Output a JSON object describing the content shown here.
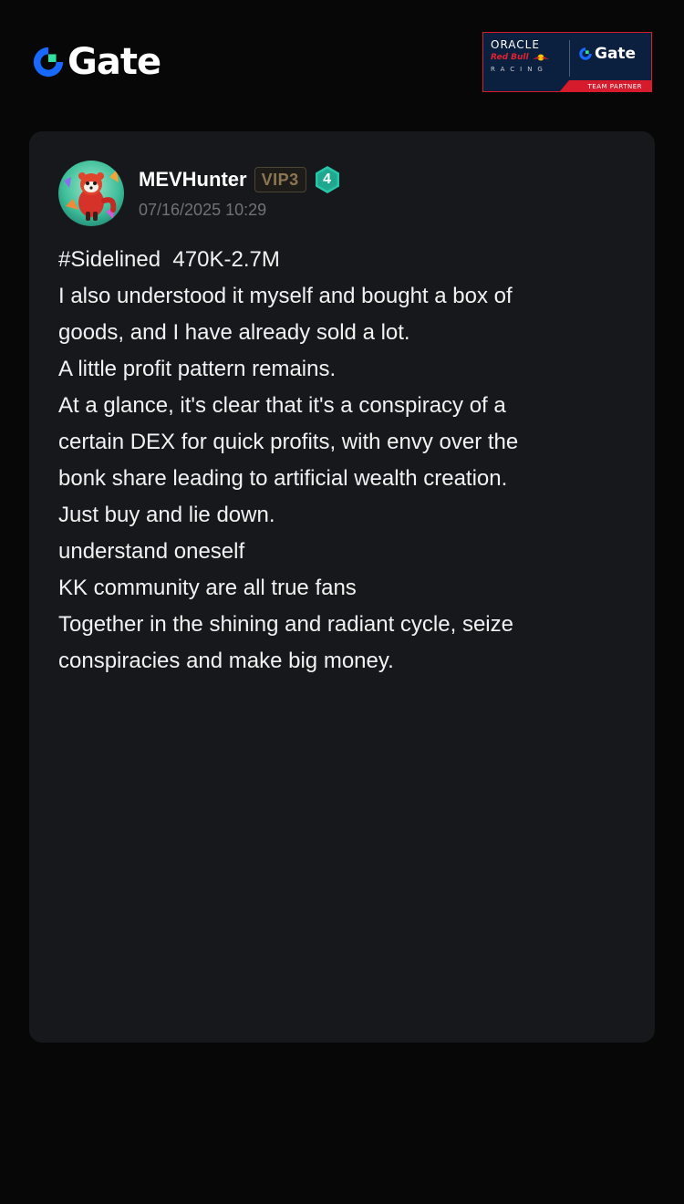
{
  "header": {
    "brand_name": "Gate",
    "logo_icon": "gate-logo-icon",
    "partner": {
      "oracle": "ORACLE",
      "red_bull": "Red Bull",
      "racing": "RACING",
      "gate": "Gate",
      "team_partner": "TEAM PARTNER"
    }
  },
  "post": {
    "author": {
      "username": "MEVHunter",
      "vip": "VIP3",
      "level": "4",
      "avatar_icon": "red-panda-avatar"
    },
    "timestamp": "07/16/2025 10:29",
    "lines": [
      "#Sidelined  470K-2.7M",
      "I also understood it myself and bought a box of",
      "goods, and I have already sold a lot.",
      "A little profit pattern remains.",
      "At a glance, it's clear that it's a conspiracy of a",
      "certain DEX for quick profits, with envy over the",
      "bonk share leading to artificial wealth creation.",
      "Just buy and lie down.",
      "understand oneself",
      "KK community are all true fans",
      "Together in the shining and radiant cycle, seize",
      "conspiracies and make big money."
    ]
  },
  "colors": {
    "background": "#070707",
    "card": "#16181b",
    "brand_blue": "#1769ff",
    "brand_green": "#2fe0a0",
    "vip_gold": "#8a7752",
    "level_teal": "#26c6a8",
    "timestamp_gray": "#6f7378"
  }
}
